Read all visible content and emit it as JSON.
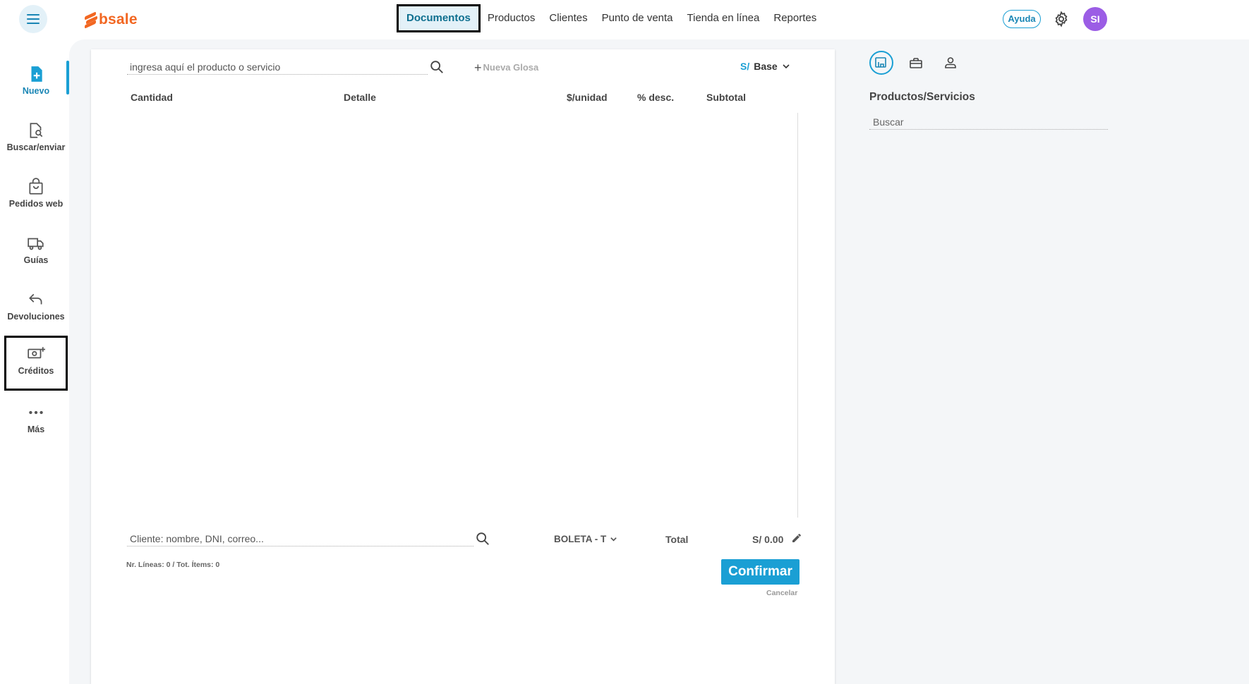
{
  "header": {
    "logo_text": "bsale",
    "nav": [
      {
        "label": "Documentos",
        "active": true
      },
      {
        "label": "Productos"
      },
      {
        "label": "Clientes"
      },
      {
        "label": "Punto de venta"
      },
      {
        "label": "Tienda en línea"
      },
      {
        "label": "Reportes"
      }
    ],
    "help_label": "Ayuda",
    "avatar_initials": "SI"
  },
  "sidebar": {
    "items": [
      {
        "label": "Nuevo",
        "icon": "new-document-icon",
        "active": true
      },
      {
        "label": "Buscar/enviar",
        "icon": "search-document-icon"
      },
      {
        "label": "Pedidos web",
        "icon": "shopping-bag-icon"
      },
      {
        "label": "Guías",
        "icon": "truck-icon"
      },
      {
        "label": "Devoluciones",
        "icon": "return-arrow-icon"
      },
      {
        "label": "Créditos",
        "icon": "cash-plus-icon"
      },
      {
        "label": "Más",
        "icon": "more-dots-icon"
      }
    ]
  },
  "document": {
    "product_search_placeholder": "ingresa aquí el producto o servicio",
    "new_gloss_label": "Nueva Glosa",
    "currency_symbol": "S/",
    "price_list": "Base",
    "columns": [
      "Cantidad",
      "Detalle",
      "$/unidad",
      "% desc.",
      "Subtotal"
    ],
    "rows": [],
    "client_search_placeholder": "Cliente: nombre, DNI, correo...",
    "document_type": "BOLETA - T",
    "total_label": "Total",
    "total_value": "S/ 0.00",
    "lines_info": "Nr. Líneas: 0 / Tot. Ítems: 0",
    "confirm_label": "Confirmar",
    "cancel_label": "Cancelar"
  },
  "right_panel": {
    "tabs": [
      "products-icon",
      "gift-icon",
      "user-icon"
    ],
    "title": "Productos/Servicios",
    "search_placeholder": "Buscar"
  },
  "colors": {
    "accent": "#1a9fd4",
    "brand": "#f26722",
    "avatar": "#9b5de5",
    "background": "#f4f6f8"
  }
}
